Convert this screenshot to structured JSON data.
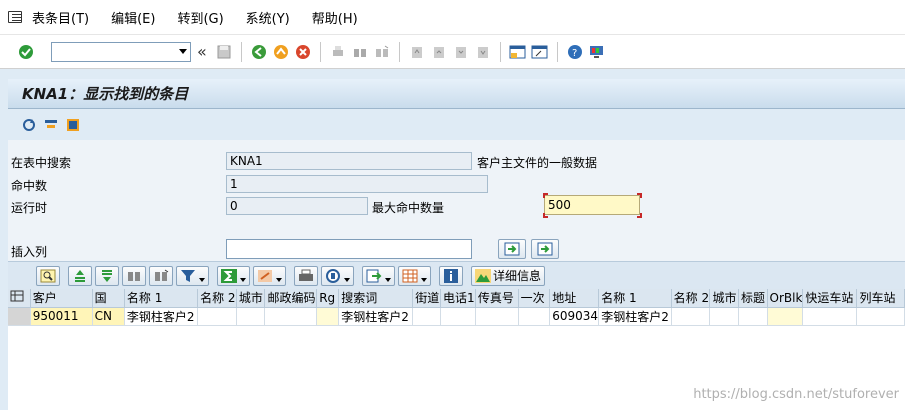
{
  "menu": {
    "items": [
      "表条目(T)",
      "编辑(E)",
      "转到(G)",
      "系统(Y)",
      "帮助(H)"
    ]
  },
  "title": "KNA1：显示找到的条目",
  "form": {
    "search_table_label": "在表中搜索",
    "search_table_value": "KNA1",
    "table_desc": "客户主文件的一般数据",
    "hits_label": "命中数",
    "hits_value": "1",
    "runtime_label": "运行时",
    "runtime_value": "0",
    "max_hits_label": "最大命中数量",
    "max_hits_value": "500",
    "insert_col_label": "插入列",
    "insert_col_value": ""
  },
  "alv": {
    "detail_label": "详细信息"
  },
  "grid": {
    "columns": [
      "客户",
      "国",
      "名称 1",
      "名称 2",
      "城市",
      "邮政编码",
      "Rg",
      "搜索词",
      "街道",
      "电话1",
      "传真号",
      "一次",
      "地址",
      "名称 1",
      "名称 2",
      "城市",
      "标题",
      "OrBlk",
      "快运车站",
      "列车站"
    ],
    "rows": [
      [
        "950011",
        "CN",
        "李钢柱客户2",
        "",
        "",
        "",
        "",
        "李钢柱客户2",
        "",
        "",
        "",
        "",
        "609034",
        "李钢柱客户2",
        "",
        "",
        "",
        "",
        "",
        ""
      ]
    ]
  },
  "watermark": "https://blog.csdn.net/stuforever",
  "colors": {
    "background": "#dfebf5",
    "key_cell": "#fff5b8",
    "active_field": "#fff9c7"
  }
}
